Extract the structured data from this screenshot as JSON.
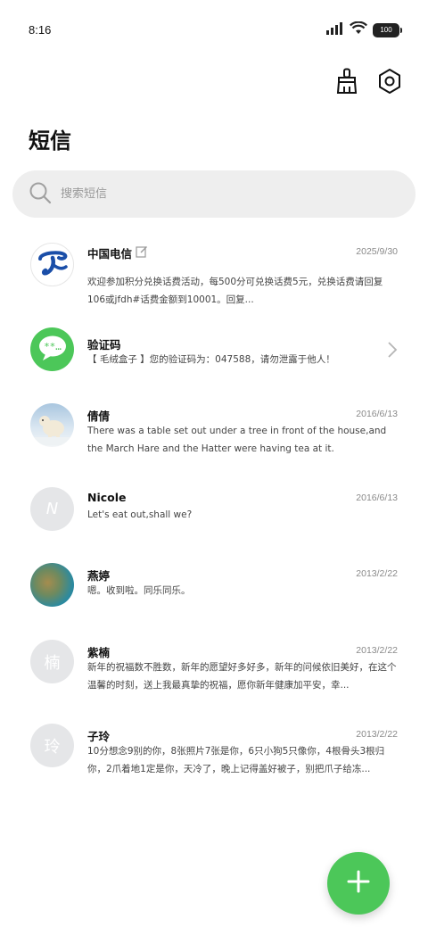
{
  "status_bar": {
    "time": "8:16",
    "battery": "100"
  },
  "page": {
    "title": "短信"
  },
  "search": {
    "placeholder": "搜索短信"
  },
  "messages": [
    {
      "name": "中国电信",
      "date": "2025/9/30",
      "preview": "欢迎参加积分兑换话费活动，每500分可兑换话费5元，兑换话费请回复106或jfdh#话费金额到10001。回复..."
    },
    {
      "name": "验证码",
      "date": "",
      "preview": "【 毛绒盒子 】您的验证码为：047588，请勿泄露于他人！"
    },
    {
      "name": "倩倩",
      "date": "2016/6/13",
      "preview": "There was a table set out under a tree in front of the house,and the March Hare and the Hatter were having tea at it."
    },
    {
      "name": "Nicole",
      "date": "2016/6/13",
      "avatar_letter": "N",
      "preview": "Let's eat out,shall we?"
    },
    {
      "name": "燕婷",
      "date": "2013/2/22",
      "preview": "嗯。收到啦。同乐同乐。"
    },
    {
      "name": "紫楠",
      "date": "2013/2/22",
      "avatar_letter": "楠",
      "preview": "新年的祝福数不胜数，新年的愿望好多好多，新年的问候依旧美好，在这个温馨的时刻，送上我最真挚的祝福，愿你新年健康加平安，幸..."
    },
    {
      "name": "子玲",
      "date": "2013/2/22",
      "avatar_letter": "玲",
      "preview": "10分想念9别的你，8张照片7张是你，6只小狗5只像你，4根骨头3根归你，2爪着地1定是你，天冷了，晚上记得盖好被子，别把爪子给冻..."
    }
  ],
  "colors": {
    "accent": "#4cc759",
    "telecom_blue": "#1a4ea8"
  }
}
